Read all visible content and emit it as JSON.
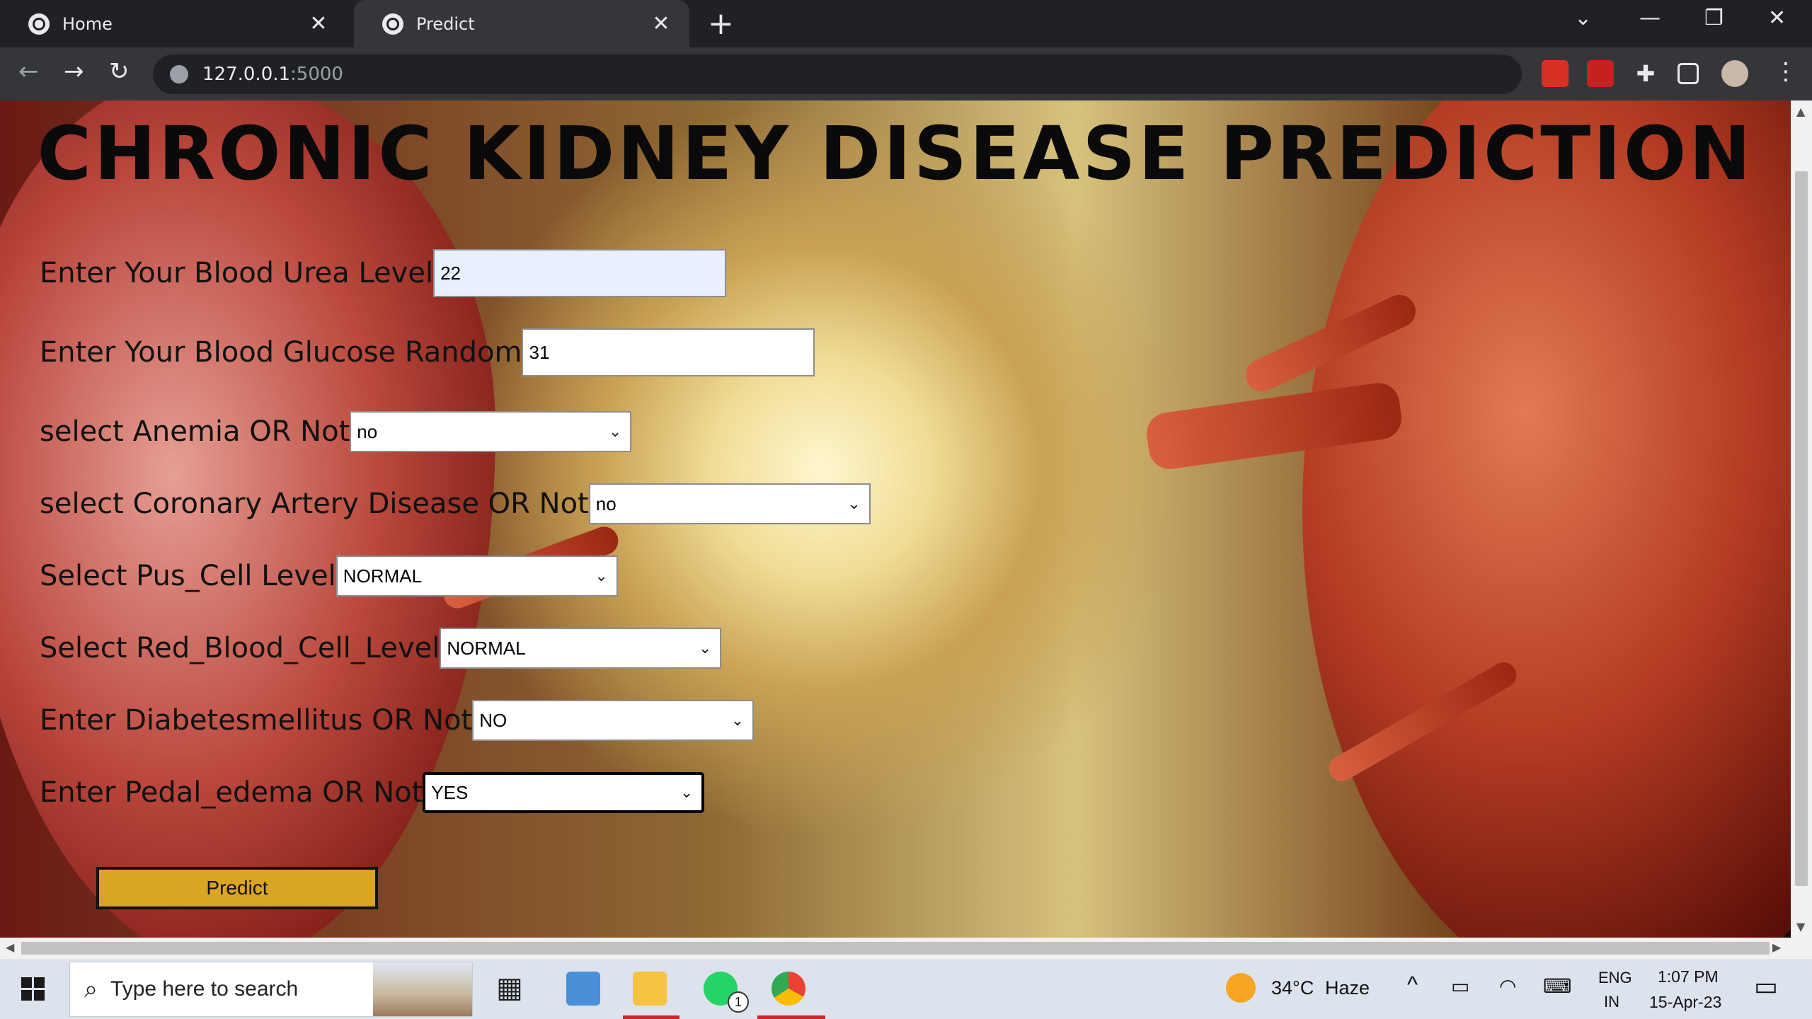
{
  "browser": {
    "tabs": [
      {
        "title": "Home",
        "active": false
      },
      {
        "title": "Predict",
        "active": true
      }
    ],
    "new_tab": "+",
    "address": {
      "host": "127.0.0.1",
      "port": ":5000"
    }
  },
  "page": {
    "title": "CHRONIC KIDNEY DISEASE PREDICTION",
    "fields": {
      "blood_urea": {
        "label": "Enter Your Blood Urea Level",
        "value": "22"
      },
      "blood_glucose": {
        "label": "Enter Your Blood Glucose Random",
        "value": "31"
      },
      "anemia": {
        "label": "select Anemia OR Not",
        "value": "no"
      },
      "coronary": {
        "label": "select Coronary Artery Disease OR Not",
        "value": "no"
      },
      "pus_cell": {
        "label": "Select Pus_Cell Level",
        "value": "NORMAL"
      },
      "red_blood_cell": {
        "label": "Select Red_Blood_Cell_Level",
        "value": "NORMAL"
      },
      "diabetes": {
        "label": "Enter Diabetesmellitus OR Not",
        "value": "NO"
      },
      "pedal_edema": {
        "label": "Enter Pedal_edema OR Not",
        "value": "YES"
      }
    },
    "predict_label": "Predict"
  },
  "taskbar": {
    "search_placeholder": "Type here to search",
    "weather": {
      "temp": "34°C",
      "condition": "Haze"
    },
    "language": {
      "line1": "ENG",
      "line2": "IN"
    },
    "clock": {
      "time": "1:07 PM",
      "date": "15-Apr-23"
    },
    "whatsapp_badge": "1"
  }
}
